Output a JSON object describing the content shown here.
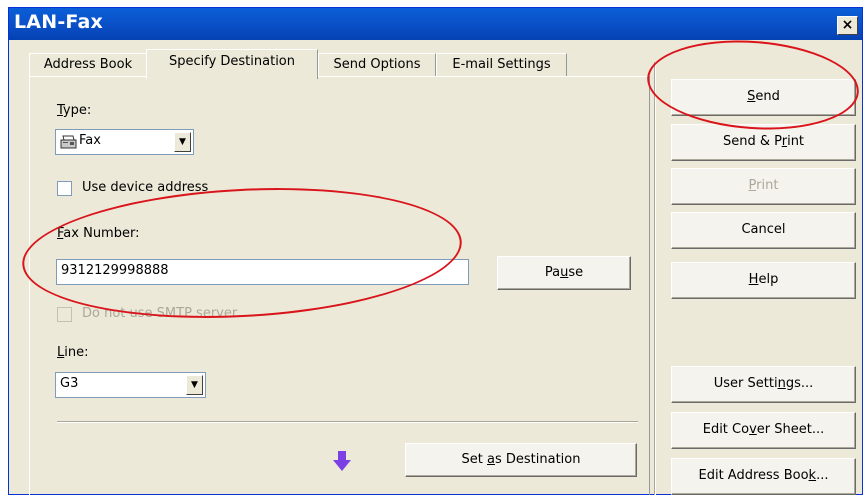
{
  "window": {
    "title": "LAN-Fax",
    "close_glyph": "×"
  },
  "tabs": [
    {
      "label": "Address Book",
      "active": false
    },
    {
      "label": "Specify Destination",
      "active": true
    },
    {
      "label": "Send Options",
      "active": false
    },
    {
      "label": "E-mail Settings",
      "active": false
    }
  ],
  "form": {
    "type_label": "Type:",
    "type_value": "Fax",
    "type_icon": "fax-machine-icon",
    "use_device_address_label": "Use device address",
    "fax_number_label": "Fax Number:",
    "fax_number_value": "9312129998888",
    "pause_label": "Pause",
    "smtp_label": "Do not use SMTP server",
    "line_label": "Line:",
    "line_value": "G3",
    "set_destination_label": "Set as Destination"
  },
  "actions": {
    "send": "Send",
    "send_print": "Send & Print",
    "print": "Print",
    "cancel": "Cancel",
    "help": "Help",
    "user_settings": "User Settings...",
    "edit_cover_sheet": "Edit Cover Sheet...",
    "edit_address_book": "Edit Address Book..."
  },
  "colors": {
    "title_bar": "#0a56cf",
    "annotation": "#d9141b",
    "arrow": "#7b3fe4"
  }
}
